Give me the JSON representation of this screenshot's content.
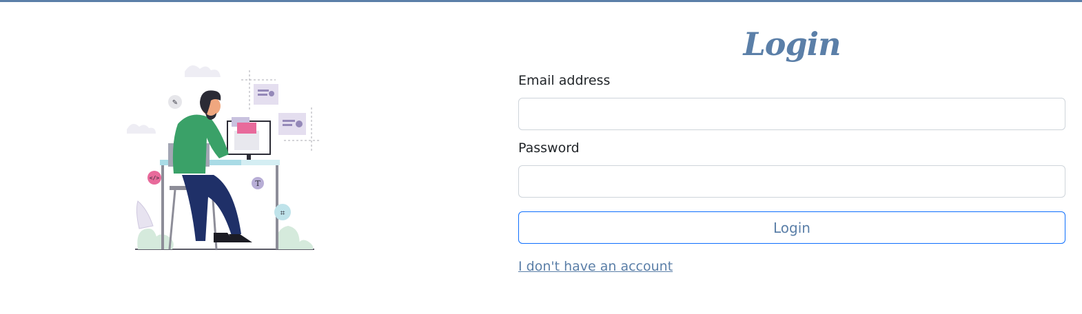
{
  "page": {
    "title": "Login"
  },
  "form": {
    "email_label": "Email address",
    "email_value": "",
    "email_placeholder": "",
    "password_label": "Password",
    "password_value": "",
    "password_placeholder": "",
    "submit_label": "Login",
    "signup_link": "I don't have an account"
  },
  "illustration": {
    "icon": "person-at-desk-illustration",
    "badges": [
      "</>",
      "T"
    ]
  },
  "colors": {
    "accent": "#5b7fa8",
    "button_border": "#0d6efd",
    "input_border": "#ced4da"
  }
}
